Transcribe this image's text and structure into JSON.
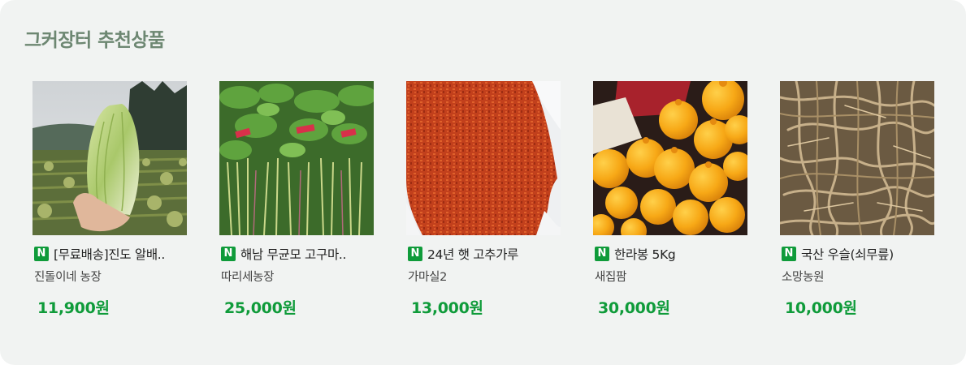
{
  "section": {
    "title": "그커장터 추천상품"
  },
  "badge_label": "N",
  "colors": {
    "accent": "#0f9b3a",
    "title": "#6d8772",
    "panel": "#f1f3f2"
  },
  "products": [
    {
      "name": "[무료배송]진도 알배..",
      "shop": "진돌이네 농장",
      "price": "11,900원",
      "image": "napa-cabbage-field-photo"
    },
    {
      "name": "해남 무균모 고구마..",
      "shop": "따리세농장",
      "price": "25,000원",
      "image": "sweet-potato-greens-photo"
    },
    {
      "name": "24년 햇 고추가루",
      "shop": "가마실2",
      "price": "13,000원",
      "image": "red-pepper-flakes-photo"
    },
    {
      "name": "한라봉 5Kg",
      "shop": "새집팜",
      "price": "30,000원",
      "image": "hallabong-oranges-photo"
    },
    {
      "name": "국산 우슬(쇠무릎)",
      "shop": "소망농원",
      "price": "10,000원",
      "image": "dried-roots-photo"
    }
  ]
}
